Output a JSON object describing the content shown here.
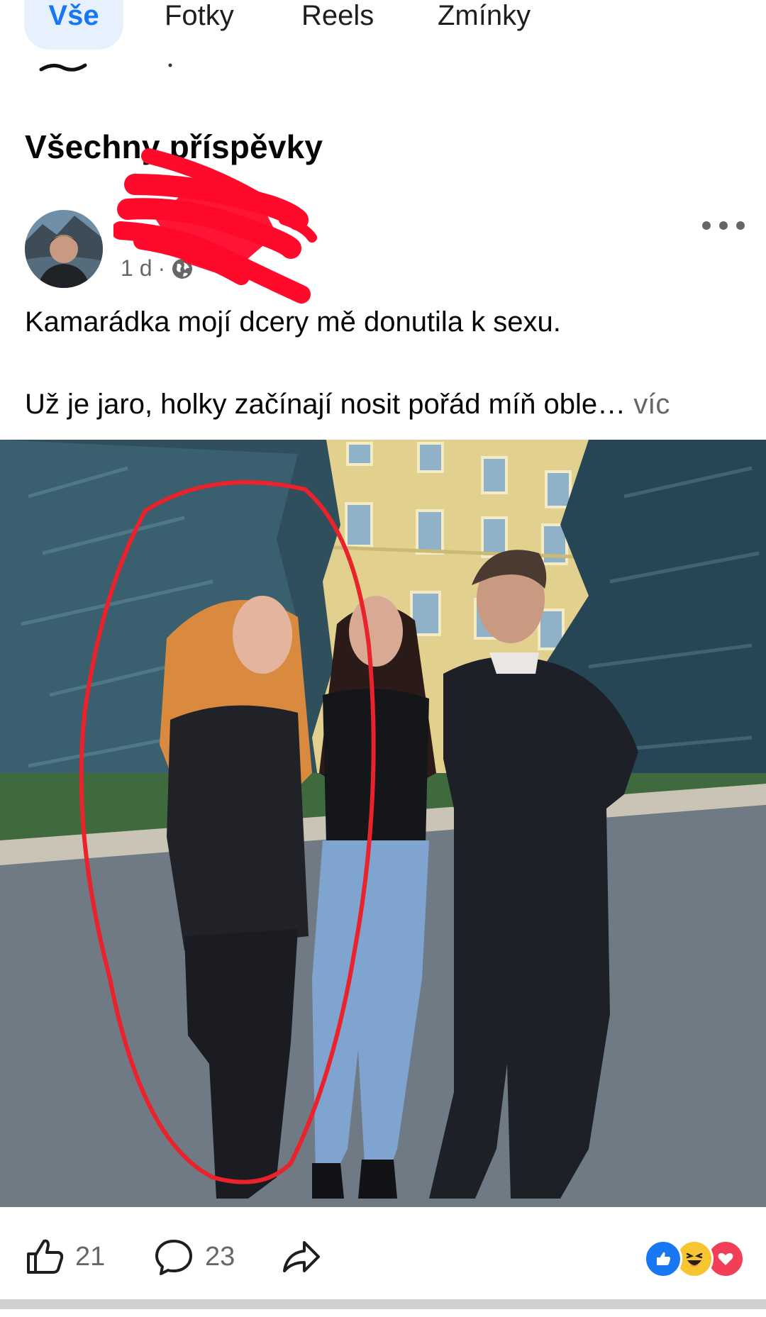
{
  "tabs": [
    {
      "label": "Vše",
      "active": true
    },
    {
      "label": "Fotky"
    },
    {
      "label": "Reels"
    },
    {
      "label": "Zmínky"
    }
  ],
  "section_title": "Všechny příspěvky",
  "post": {
    "author": "",
    "time": "1 d",
    "visibility_icon": "globe-icon",
    "text_line1": "Kamarádka mojí dcery mě donutila k sexu.",
    "text_line2": "Už je jaro, holky začínají nosit pořád míň oble…",
    "more_label": "víc",
    "photo_description_icon": "photo"
  },
  "actions": {
    "like_count": "21",
    "comment_count": "23",
    "reactions": [
      "like",
      "haha",
      "love"
    ]
  },
  "colors": {
    "accent": "#1877f2",
    "tab_active_bg": "#e7f0fd",
    "scribble": "#ff0a2a",
    "secondary_text": "#65676b"
  }
}
